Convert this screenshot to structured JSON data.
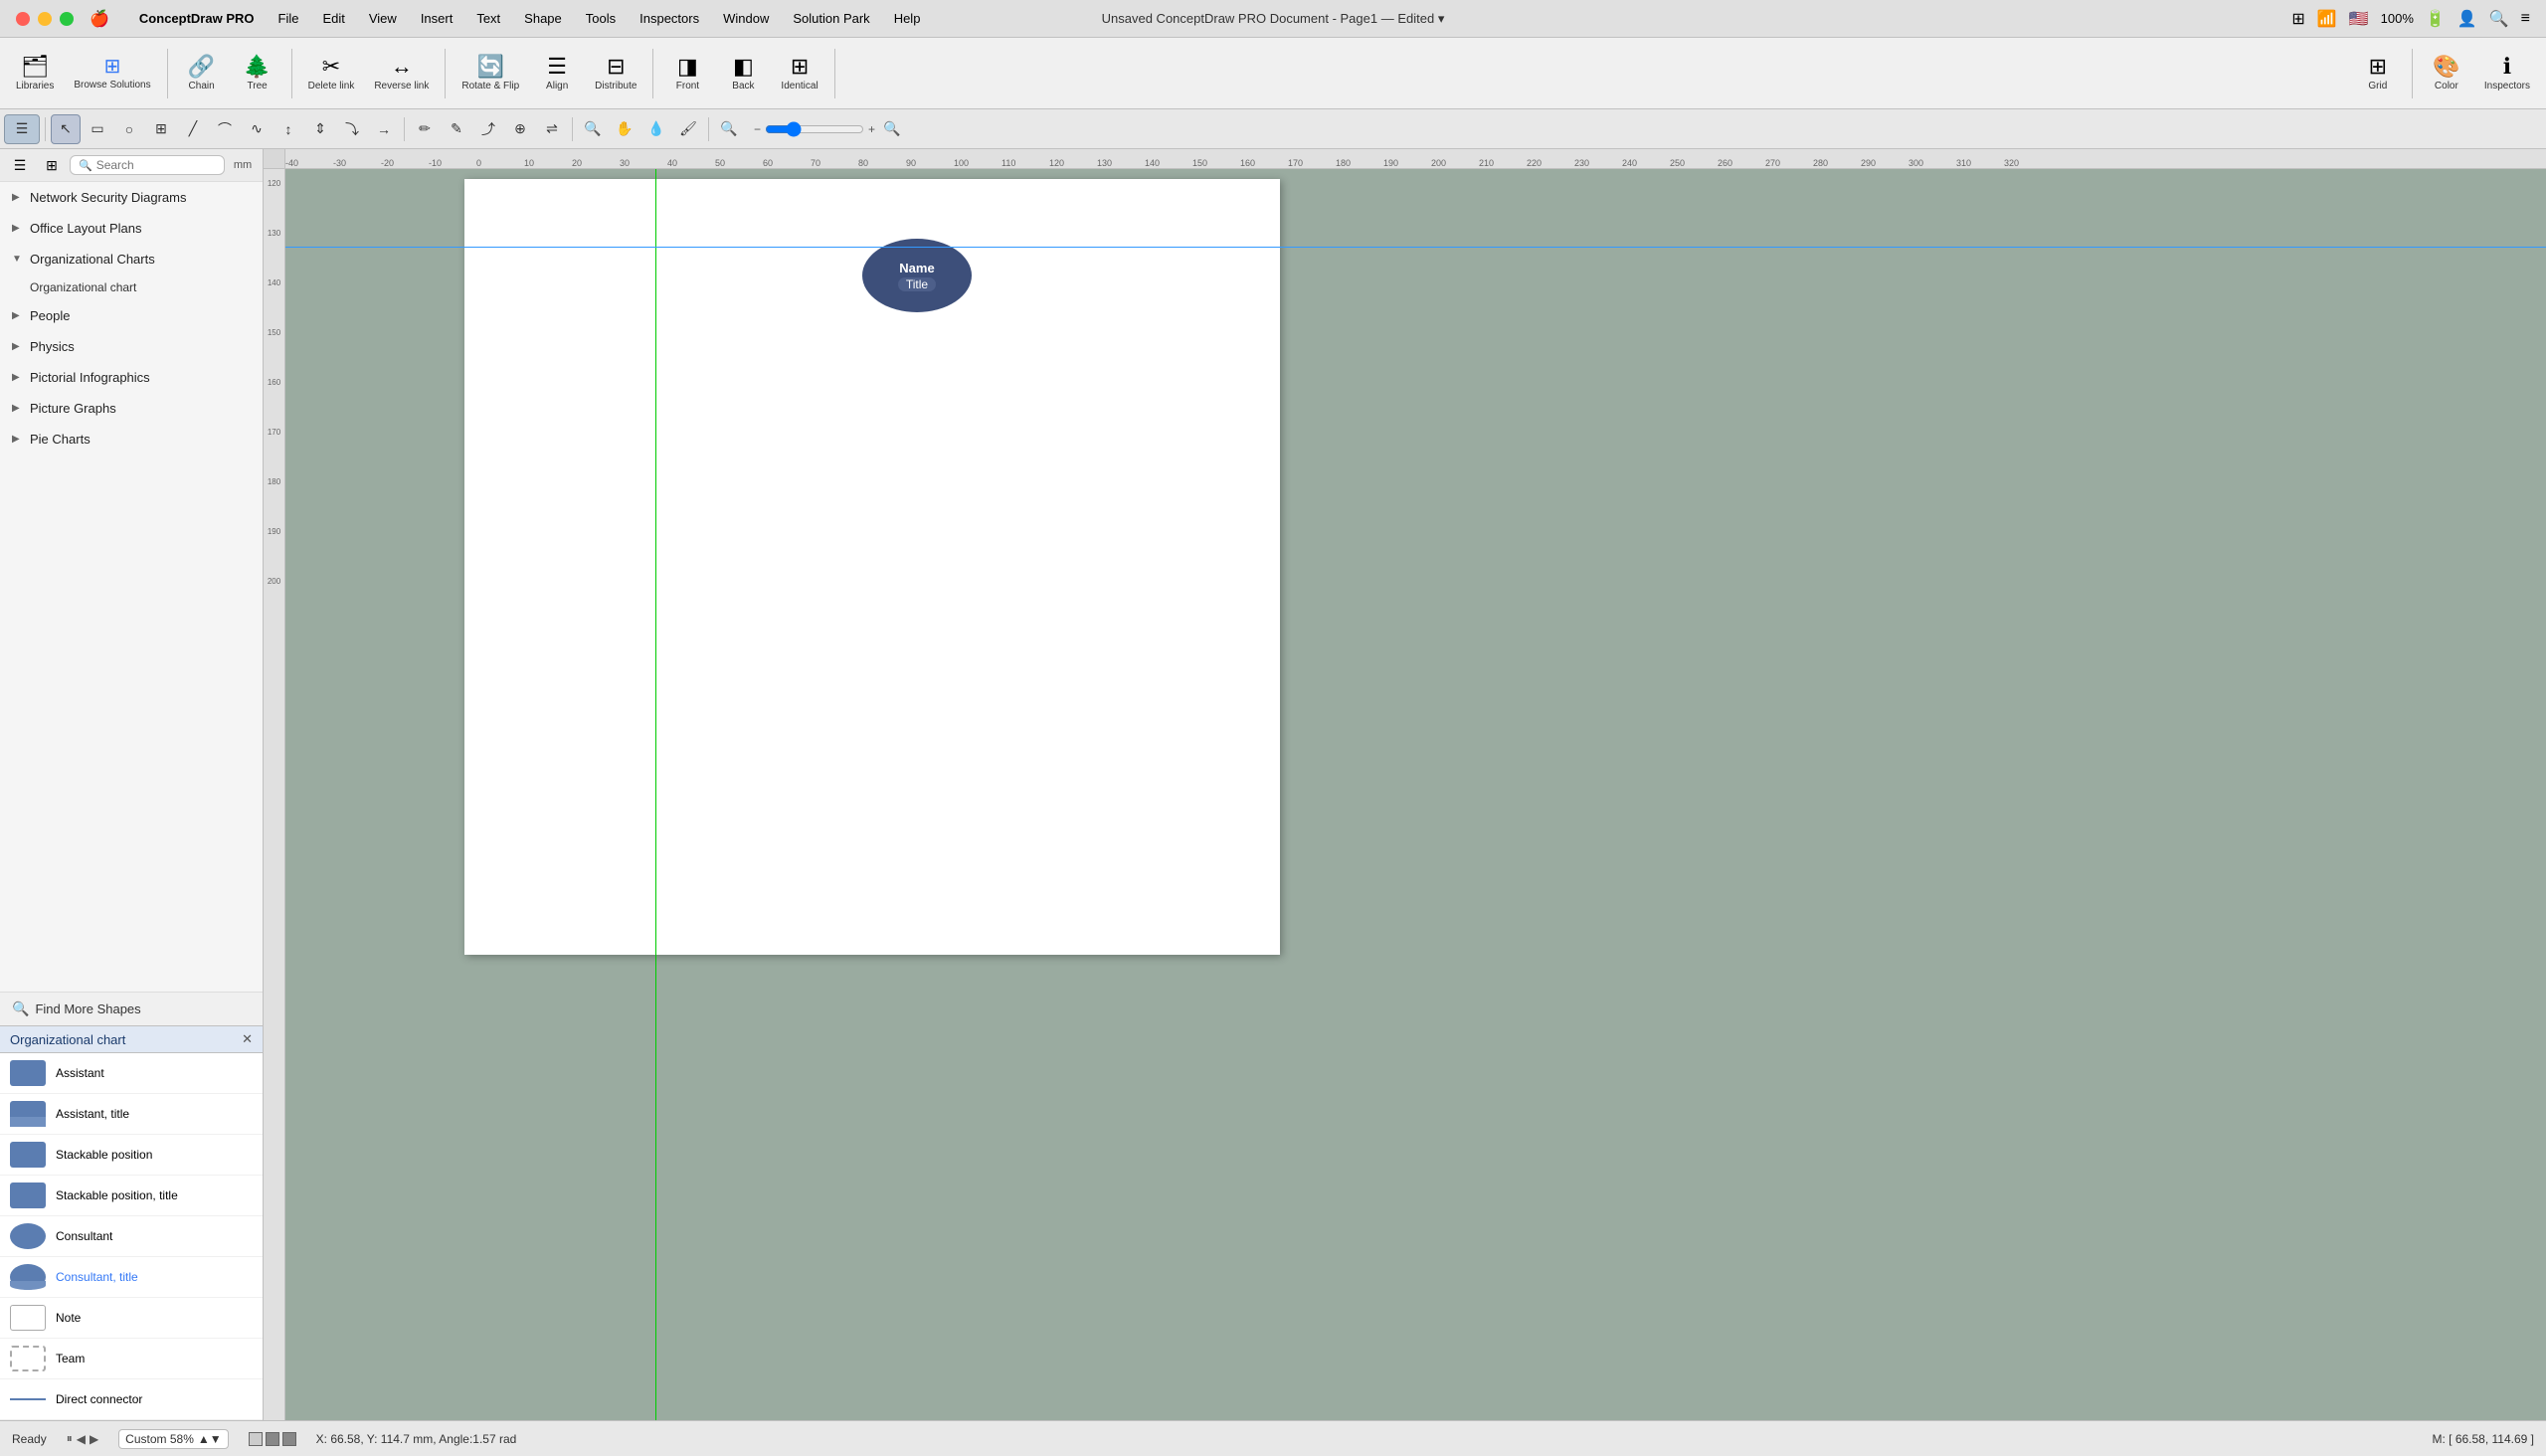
{
  "titlebar": {
    "app_name": "ConceptDraw PRO",
    "menus": [
      "File",
      "Edit",
      "View",
      "Insert",
      "Text",
      "Shape",
      "Tools",
      "Inspectors",
      "Window",
      "Solution Park",
      "Help"
    ],
    "doc_title": "Unsaved ConceptDraw PRO Document - Page1",
    "doc_status": "Edited",
    "zoom_pct": "100%"
  },
  "toolbar": {
    "buttons": [
      {
        "id": "libraries",
        "icon": "🗂",
        "label": "Libraries"
      },
      {
        "id": "browse-solutions",
        "icon": "🟦",
        "label": "Browse Solutions"
      },
      {
        "id": "chain",
        "icon": "🔗",
        "label": "Chain"
      },
      {
        "id": "tree",
        "icon": "🌲",
        "label": "Tree"
      },
      {
        "id": "delete-link",
        "icon": "✂",
        "label": "Delete link"
      },
      {
        "id": "reverse-link",
        "icon": "↔",
        "label": "Reverse link"
      },
      {
        "id": "rotate-flip",
        "icon": "🔄",
        "label": "Rotate & Flip"
      },
      {
        "id": "align",
        "icon": "≡",
        "label": "Align"
      },
      {
        "id": "distribute",
        "icon": "⊞",
        "label": "Distribute"
      },
      {
        "id": "front",
        "icon": "◨",
        "label": "Front"
      },
      {
        "id": "back",
        "icon": "◧",
        "label": "Back"
      },
      {
        "id": "identical",
        "icon": "⊟",
        "label": "Identical"
      },
      {
        "id": "grid",
        "icon": "⊞",
        "label": "Grid"
      },
      {
        "id": "color",
        "icon": "🎨",
        "label": "Color"
      },
      {
        "id": "inspectors",
        "icon": "ℹ",
        "label": "Inspectors"
      }
    ]
  },
  "sidebar": {
    "search_placeholder": "Search",
    "library_items": [
      {
        "id": "network-security",
        "label": "Network Security Diagrams",
        "expanded": false
      },
      {
        "id": "office-layout",
        "label": "Office Layout Plans",
        "expanded": false
      },
      {
        "id": "org-charts",
        "label": "Organizational Charts",
        "expanded": true
      },
      {
        "id": "org-chart-sub",
        "label": "Organizational chart",
        "is_sub": true
      },
      {
        "id": "people",
        "label": "People",
        "expanded": false
      },
      {
        "id": "physics",
        "label": "Physics",
        "expanded": false
      },
      {
        "id": "pictorial",
        "label": "Pictorial Infographics",
        "expanded": false
      },
      {
        "id": "picture-graphs",
        "label": "Picture Graphs",
        "expanded": false
      },
      {
        "id": "pie-charts",
        "label": "Pie Charts",
        "expanded": false
      }
    ],
    "find_more_label": "Find More Shapes"
  },
  "shapes_panel": {
    "title": "Organizational chart",
    "shapes": [
      {
        "id": "assistant",
        "label": "Assistant",
        "thumb_type": "blue-rect"
      },
      {
        "id": "assistant-title",
        "label": "Assistant, title",
        "thumb_type": "blue-rect"
      },
      {
        "id": "stackable",
        "label": "Stackable position",
        "thumb_type": "blue-rect"
      },
      {
        "id": "stackable-title",
        "label": "Stackable position, title",
        "thumb_type": "blue-rect"
      },
      {
        "id": "consultant",
        "label": "Consultant",
        "thumb_type": "blue-ellipse"
      },
      {
        "id": "consultant-title",
        "label": "Consultant, title",
        "thumb_type": "blue-ellipse",
        "highlighted": true
      },
      {
        "id": "note",
        "label": "Note",
        "thumb_type": "white-rect"
      },
      {
        "id": "team",
        "label": "Team",
        "thumb_type": "team-rect"
      },
      {
        "id": "direct-connector",
        "label": "Direct connector",
        "thumb_type": "connector-line"
      }
    ]
  },
  "canvas": {
    "shape": {
      "name_text": "Name",
      "title_text": "Title"
    },
    "mm_label": "mm"
  },
  "status_bar": {
    "ready_label": "Ready",
    "zoom_label": "Custom 58%",
    "coords_left": "X: 66.58, Y: 114.7 mm, Angle:1.57 rad",
    "coords_right": "M: [ 66.58, 114.69 ]"
  },
  "ruler": {
    "h_ticks": [
      "-40",
      "-30",
      "-20",
      "-10",
      "0",
      "10",
      "20",
      "30",
      "40",
      "50",
      "60",
      "70",
      "80",
      "90",
      "100",
      "110",
      "120",
      "130",
      "140",
      "150",
      "160",
      "170",
      "180",
      "190",
      "200",
      "210",
      "220",
      "230",
      "240",
      "250",
      "260",
      "270",
      "280",
      "290",
      "300",
      "310",
      "320"
    ],
    "v_ticks": [
      "120",
      "130",
      "140",
      "150",
      "160",
      "170",
      "180",
      "190",
      "200"
    ]
  }
}
